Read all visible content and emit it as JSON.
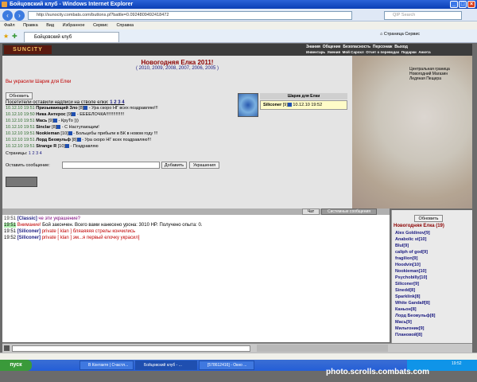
{
  "window": {
    "title": "Бойцовский клуб - Windows Internet Explorer"
  },
  "address": {
    "url": "http://sunocity.combats.com/buttons.pl?battle=0.0924809492418472",
    "search_placeholder": "QIP Search"
  },
  "menu": [
    "Файл",
    "Правка",
    "Вид",
    "Избранное",
    "Сервис",
    "Справка"
  ],
  "tab": {
    "label": "Бойцовский клуб"
  },
  "tools": {
    "page": "Страница",
    "service": "Сервис"
  },
  "game": {
    "logo": "SUNCITY",
    "nav_top": [
      "Знания",
      "Общение",
      "Безопасность",
      "Персонаж",
      "Выход"
    ],
    "nav_bottom": [
      "Инвентарь",
      "Умения",
      "Мой Сарохл",
      "Отчет о переводах",
      "Подарки",
      "Анкета"
    ],
    "right_links": [
      "Центральная граница",
      "Новогодний Магазин",
      "Ледяная Пещера"
    ],
    "heading": "Новогодняя Елка 2011!",
    "years": "( 2010, 2009, 2008, 2007, 2006, 2005 )",
    "decorated": "Вы украсили Шарик для Елки",
    "refresh_button": "Обновить",
    "visitors_title": "Посетители оставили надписи на стволе елки:",
    "visitor_pages": "1 2 3 4",
    "messages": [
      {
        "time": "10.12.10 19:51",
        "name": "Призывающий Зло",
        "level": "[8]",
        "text": "- Ура скоро НГ всех поздравляю!!!"
      },
      {
        "time": "10.12.10 19:50",
        "name": "Ника Антерос",
        "level": "[9]",
        "text": "- ЕЕЕЕЛОЧКА!!!!!!!!!!!!!!!"
      },
      {
        "time": "10.12.10 19:51",
        "name": "Macь",
        "level": "[9]",
        "text": "- КруТо )))"
      },
      {
        "time": "10.12.10 19:51",
        "name": "Sinclar",
        "level": "[8]",
        "text": "- С Наступающим!"
      },
      {
        "time": "10.12.10 19:51",
        "name": "Nookieman",
        "level": "[10]",
        "text": "- Больцебы прибыли в БК в новом году !!!"
      },
      {
        "time": "10.12.10 19:51",
        "name": "Лорд Беовульф",
        "level": "[8]",
        "text": "- Ура скоро НГ всех поздравляю!!!"
      },
      {
        "time": "10.12.10 19:51",
        "name": "Strange R",
        "level": "[10]",
        "text": "- Поздравляю"
      }
    ],
    "pages_label": "Страницы:",
    "pages": "1 2 3 4",
    "leave_message_label": "Оставить сообщение:",
    "add_button": "Добавить",
    "decorations_button": "Украшения",
    "ball": {
      "title": "Шарик для Елки",
      "owner": "Siliconer",
      "level": "[9]",
      "date": "10.12.10 19:52"
    }
  },
  "chat_tabs": [
    "Чат",
    "Системные сообщения"
  ],
  "chat": [
    {
      "time": "19:51",
      "sender": "[CIassic]",
      "text": "че эти украшение?"
    },
    {
      "time": "19:51",
      "sender": "Внимание!",
      "text": "Бой закончен. Всего вами нанесено урона: 3010 HP. Получено опыта: 0."
    },
    {
      "time": "19:51",
      "sender": "[Siliconer]",
      "text": "private [ klan ] бляаяяяя стрелы кончились"
    },
    {
      "time": "19:52",
      "sender": "[Siliconer]",
      "text": "private [ klan ] эм...я первый елочку украсил]"
    }
  ],
  "room": {
    "refresh": "Обновить",
    "title": "Новогодняя Елка (19)"
  },
  "users": [
    {
      "name": "Alex Goldinov",
      "level": "[9]"
    },
    {
      "name": "Anabolic st",
      "level": "[10]"
    },
    {
      "name": "Blul",
      "level": "[9]"
    },
    {
      "name": "caliph of god",
      "level": "[9]"
    },
    {
      "name": "fragilion",
      "level": "[9]"
    },
    {
      "name": "Hoodvin",
      "level": "[10]"
    },
    {
      "name": "Nookieman",
      "level": "[10]"
    },
    {
      "name": "Psychobilly",
      "level": "[10]"
    },
    {
      "name": "Siliconer",
      "level": "[9]"
    },
    {
      "name": "Sinedd",
      "level": "[8]"
    },
    {
      "name": "Sparklink",
      "level": "[8]"
    },
    {
      "name": "White Gandalf",
      "level": "[8]"
    },
    {
      "name": "Каньон",
      "level": "[8]"
    },
    {
      "name": "Лорд Беовульф",
      "level": "[8]"
    },
    {
      "name": "Macь",
      "level": "[9]"
    },
    {
      "name": "Мильтоник",
      "level": "[9]"
    },
    {
      "name": "Плановой",
      "level": "[8]"
    }
  ],
  "taskbar": {
    "start": "пуск",
    "items": [
      "В Контакте | Счастл...",
      "Бойцовский клуб - ...",
      "[578612416] - Окно ..."
    ],
    "clock": "19:52"
  },
  "watermark": "photo.scrolls.combats.com"
}
